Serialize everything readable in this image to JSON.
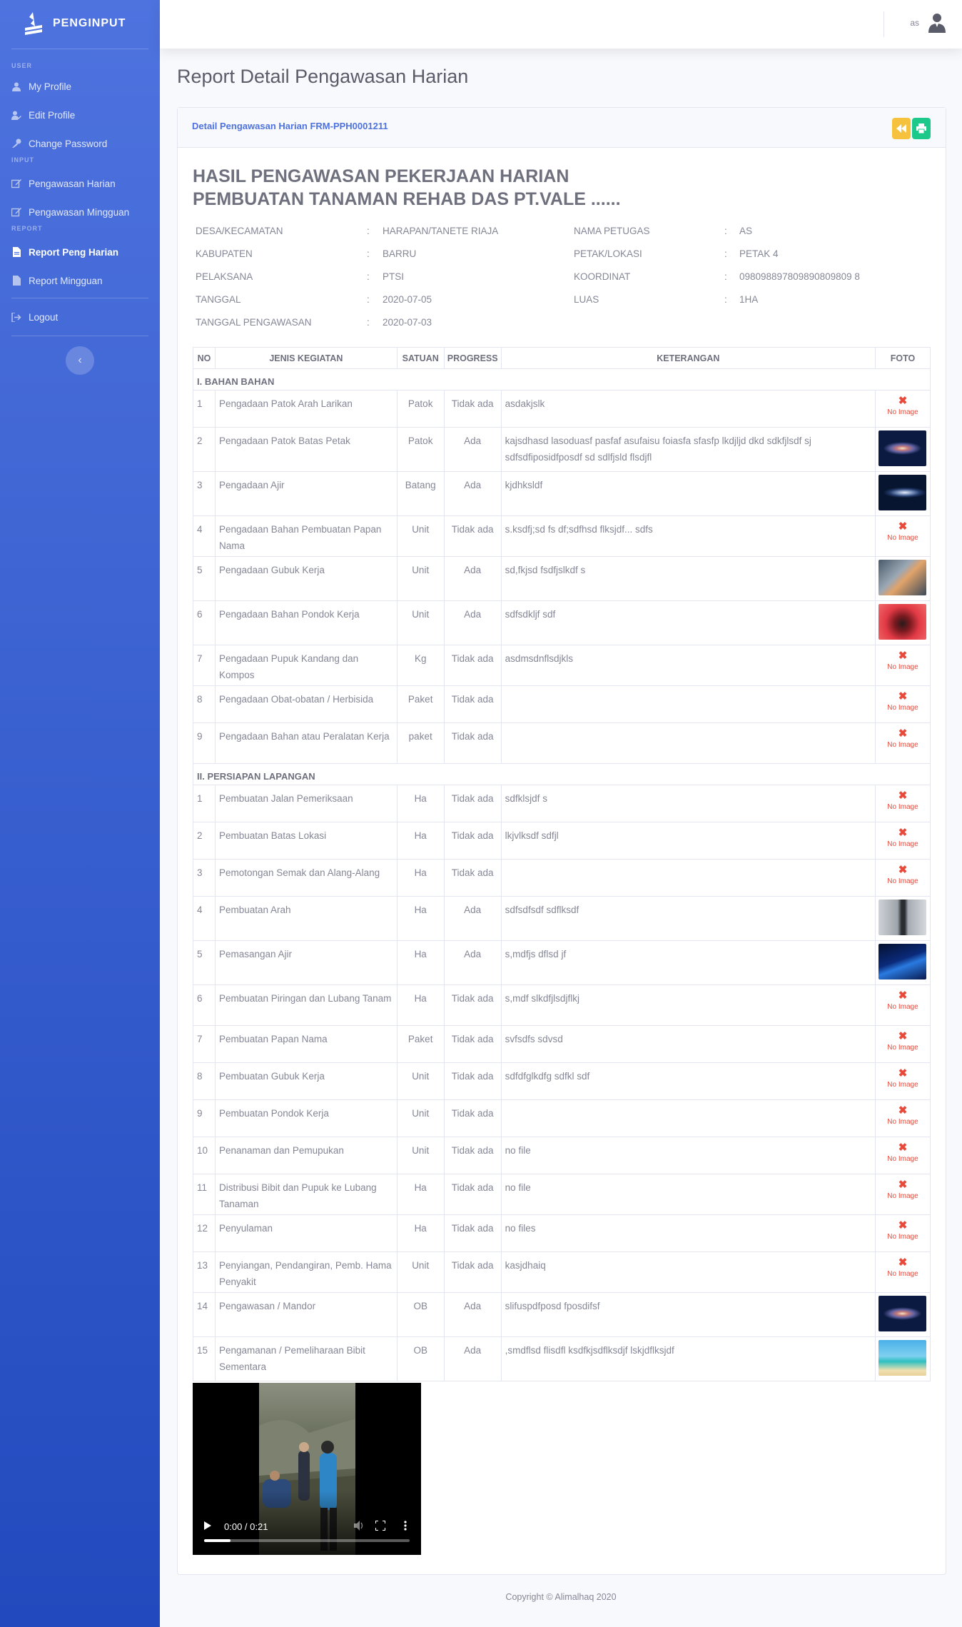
{
  "sidebar": {
    "brand": "PENGINPUT",
    "headings": {
      "user": "USER",
      "input": "INPUT",
      "report": "REPORT"
    },
    "items": [
      {
        "label": "My Profile",
        "icon": "user-icon"
      },
      {
        "label": "Edit Profile",
        "icon": "user-edit-icon"
      },
      {
        "label": "Change Password",
        "icon": "key-icon"
      },
      {
        "label": "Pengawasan Harian",
        "icon": "edit-icon"
      },
      {
        "label": "Pengawasan Mingguan",
        "icon": "edit-icon"
      },
      {
        "label": "Report Peng Harian",
        "icon": "file-icon",
        "active": true
      },
      {
        "label": "Report Mingguan",
        "icon": "file-icon"
      },
      {
        "label": "Logout",
        "icon": "sign-out-icon"
      }
    ],
    "toggle": "‹"
  },
  "topbar": {
    "username": "as"
  },
  "page": {
    "title": "Report Detail Pengawasan Harian"
  },
  "card": {
    "header": "Detail Pengawasan Harian FRM-PPH0001211",
    "doc_title_1": "HASIL PENGAWASAN PEKERJAAN HARIAN",
    "doc_title_2": "PEMBUATAN TANAMAN REHAB DAS PT.VALE ......"
  },
  "info_left": [
    {
      "label": "DESA/KECAMATAN",
      "value": "HARAPAN/TANETE RIAJA"
    },
    {
      "label": "KABUPATEN",
      "value": "BARRU"
    },
    {
      "label": "PELAKSANA",
      "value": "PTSI"
    },
    {
      "label": "TANGGAL",
      "value": "2020-07-05"
    },
    {
      "label": "TANGGAL PENGAWASAN",
      "value": "2020-07-03"
    }
  ],
  "info_right": [
    {
      "label": "NAMA PETUGAS",
      "value": "AS"
    },
    {
      "label": "PETAK/LOKASI",
      "value": "PETAK 4"
    },
    {
      "label": "KOORDINAT",
      "value": "098098897809890809809 8"
    },
    {
      "label": "LUAS",
      "value": "1HA"
    }
  ],
  "colon": ":",
  "table": {
    "headers": [
      "NO",
      "JENIS KEGIATAN",
      "SATUAN",
      "PROGRESS",
      "KETERANGAN",
      "FOTO"
    ],
    "no_image": "No Image",
    "sections": [
      {
        "title": "I. BAHAN BAHAN",
        "rows": [
          {
            "no": "1",
            "kegiatan": "Pengadaan Patok Arah Larikan",
            "satuan": "Patok",
            "progress": "Tidak ada",
            "keterangan": "asdakjslk",
            "foto": null,
            "h": 52
          },
          {
            "no": "2",
            "kegiatan": "Pengadaan Patok Batas Petak",
            "satuan": "Patok",
            "progress": "Ada",
            "keterangan": "kajsdhasd lasoduasf pasfaf asufaisu foiasfa sfasfp lkdjljd dkd sdkfjlsdf sj sdfsdfiposidfposdf sd sdlfjsld flsdjfl",
            "foto": "galaxy",
            "h": 59
          },
          {
            "no": "3",
            "kegiatan": "Pengadaan Ajir",
            "satuan": "Batang",
            "progress": "Ada",
            "keterangan": "kjdhksldf",
            "foto": "galaxy2",
            "h": 59
          },
          {
            "no": "4",
            "kegiatan": "Pengadaan Bahan Pembuatan Papan Nama",
            "satuan": "Unit",
            "progress": "Tidak ada",
            "keterangan": "s.ksdfj;sd fs df;sdfhsd flksjdf... sdfs",
            "foto": null,
            "h": 57
          },
          {
            "no": "5",
            "kegiatan": "Pengadaan Gubuk Kerja",
            "satuan": "Unit",
            "progress": "Ada",
            "keterangan": "sd,fkjsd fsdfjslkdf s",
            "foto": "abstract",
            "h": 59
          },
          {
            "no": "6",
            "kegiatan": "Pengadaan Bahan Pondok Kerja",
            "satuan": "Unit",
            "progress": "Ada",
            "keterangan": "sdfsdkljf sdf",
            "foto": "red",
            "h": 59
          },
          {
            "no": "7",
            "kegiatan": "Pengadaan Pupuk Kandang dan Kompos",
            "satuan": "Kg",
            "progress": "Tidak ada",
            "keterangan": "asdmsdnflsdjkls",
            "foto": null,
            "h": 57
          },
          {
            "no": "8",
            "kegiatan": "Pengadaan Obat-obatan / Herbisida",
            "satuan": "Paket",
            "progress": "Tidak ada",
            "keterangan": "",
            "foto": null,
            "h": 52
          },
          {
            "no": "9",
            "kegiatan": "Pengadaan Bahan atau Peralatan Kerja",
            "satuan": "paket",
            "progress": "Tidak ada",
            "keterangan": "",
            "foto": null,
            "h": 57
          }
        ]
      },
      {
        "title": "II. PERSIAPAN LAPANGAN",
        "rows": [
          {
            "no": "1",
            "kegiatan": "Pembuatan Jalan Pemeriksaan",
            "satuan": "Ha",
            "progress": "Tidak ada",
            "keterangan": "sdfklsjdf s",
            "foto": null,
            "h": 52
          },
          {
            "no": "2",
            "kegiatan": "Pembuatan Batas Lokasi",
            "satuan": "Ha",
            "progress": "Tidak ada",
            "keterangan": "lkjvlksdf sdfjl",
            "foto": null,
            "h": 52
          },
          {
            "no": "3",
            "kegiatan": "Pemotongan Semak dan Alang-Alang",
            "satuan": "Ha",
            "progress": "Tidak ada",
            "keterangan": "",
            "foto": null,
            "h": 52
          },
          {
            "no": "4",
            "kegiatan": "Pembuatan Arah",
            "satuan": "Ha",
            "progress": "Ada",
            "keterangan": "sdfsdfsdf sdflksdf",
            "foto": "robot",
            "h": 59
          },
          {
            "no": "5",
            "kegiatan": "Pemasangan Ajir",
            "satuan": "Ha",
            "progress": "Ada",
            "keterangan": "s,mdfjs dflsd jf",
            "foto": "windows",
            "h": 59
          },
          {
            "no": "6",
            "kegiatan": "Pembuatan Piringan dan Lubang Tanam",
            "satuan": "Ha",
            "progress": "Tidak ada",
            "keterangan": "s,mdf slkdfjlsdjflkj",
            "foto": null,
            "h": 57
          },
          {
            "no": "7",
            "kegiatan": "Pembuatan Papan Nama",
            "satuan": "Paket",
            "progress": "Tidak ada",
            "keterangan": "svfsdfs sdvsd",
            "foto": null,
            "h": 52
          },
          {
            "no": "8",
            "kegiatan": "Pembuatan Gubuk Kerja",
            "satuan": "Unit",
            "progress": "Tidak ada",
            "keterangan": "sdfdfglkdfg sdfkl sdf",
            "foto": null,
            "h": 52
          },
          {
            "no": "9",
            "kegiatan": "Pembuatan Pondok Kerja",
            "satuan": "Unit",
            "progress": "Tidak ada",
            "keterangan": "",
            "foto": null,
            "h": 52
          },
          {
            "no": "10",
            "kegiatan": "Penanaman dan Pemupukan",
            "satuan": "Unit",
            "progress": "Tidak ada",
            "keterangan": "no file",
            "foto": null,
            "h": 52
          },
          {
            "no": "11",
            "kegiatan": "Distribusi Bibit dan Pupuk ke Lubang Tanaman",
            "satuan": "Ha",
            "progress": "Tidak ada",
            "keterangan": "no file",
            "foto": null,
            "h": 57
          },
          {
            "no": "12",
            "kegiatan": "Penyulaman",
            "satuan": "Ha",
            "progress": "Tidak ada",
            "keterangan": "no files",
            "foto": null,
            "h": 52
          },
          {
            "no": "13",
            "kegiatan": "Penyiangan, Pendangiran, Pemb. Hama Penyakit",
            "satuan": "Unit",
            "progress": "Tidak ada",
            "keterangan": "kasjdhaiq",
            "foto": null,
            "h": 57
          },
          {
            "no": "14",
            "kegiatan": "Pengawasan / Mandor",
            "satuan": "OB",
            "progress": "Ada",
            "keterangan": "slifuspdfposd fposdifsf",
            "foto": "galaxy",
            "h": 59
          },
          {
            "no": "15",
            "kegiatan": "Pengamanan / Pemeliharaan Bibit Sementara",
            "satuan": "OB",
            "progress": "Ada",
            "keterangan": ",smdflsd flisdfl ksdfkjsdflksdjf lskjdflksjdf",
            "foto": "beach",
            "h": 59
          }
        ]
      }
    ]
  },
  "video": {
    "time": "0:00 / 0:21",
    "progress": 0.13
  },
  "footer": "Copyright © Alimalhaq 2020",
  "colors": {
    "primary": "#4e73df",
    "warning": "#f6c23e",
    "success": "#1cc88a",
    "danger": "#e74a3b"
  }
}
